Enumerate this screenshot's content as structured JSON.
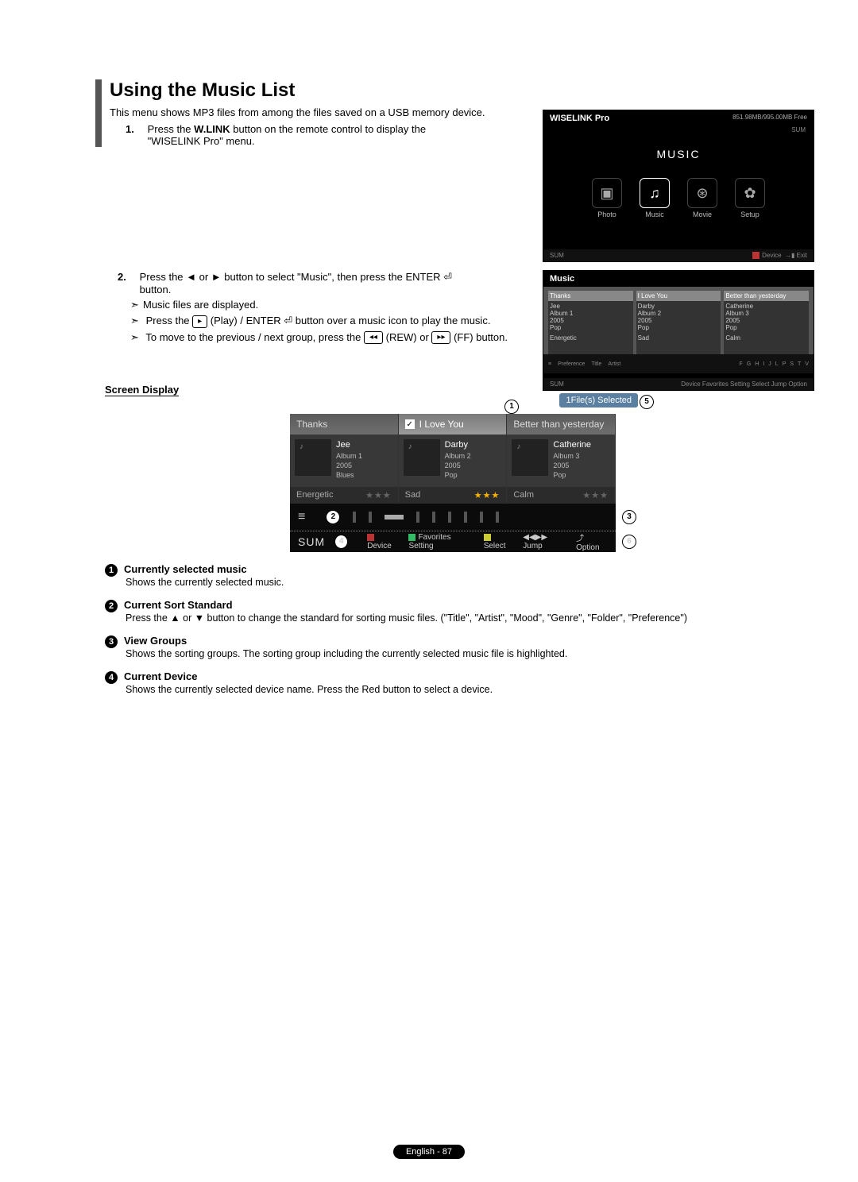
{
  "title": "Using the Music List",
  "intro": "This menu shows MP3 files from among the files saved on a USB memory device.",
  "steps": {
    "s1_pre": "Press the ",
    "s1_bold": "W.LINK",
    "s1_post": " button on the remote control to display the \"WISELINK Pro\" menu.",
    "s2_main": "Press the ◄ or ► button to select \"Music\", then press the ENTER ⏎ button.",
    "s2_a": "Music files are displayed.",
    "s2_b_pre": "Press the ",
    "s2_b_mid": " (Play) / ENTER ⏎ button over a music icon to play the music.",
    "s2_c_pre": "To move to the previous / next group, press the ",
    "s2_c_mid": " (REW) or ",
    "s2_c_end": " (FF) button."
  },
  "ss1": {
    "header": "WISELINK Pro",
    "storage": "851.98MB/995.00MB Free",
    "sub": "SUM",
    "main": "MUSIC",
    "icons": [
      "Photo",
      "Music",
      "Movie",
      "Setup"
    ],
    "foot_l": "SUM",
    "foot_r1": "Device",
    "foot_r2": "Exit"
  },
  "ss2": {
    "header": "Music",
    "tiles": [
      {
        "h": "Thanks",
        "n": "Jee",
        "a": "Album 1",
        "y": "2005",
        "g": "Pop",
        "m": "Energetic"
      },
      {
        "h": "I Love You",
        "n": "Darby",
        "a": "Album 2",
        "y": "2005",
        "g": "Pop",
        "m": "Sad"
      },
      {
        "h": "Better than yesterday",
        "n": "Catherine",
        "a": "Album 3",
        "y": "2005",
        "g": "Pop",
        "m": "Calm"
      }
    ],
    "sort_labels": [
      "Preference",
      "Title",
      "Artist"
    ],
    "letters": [
      "F",
      "G",
      "H",
      "I",
      "J",
      "L",
      "P",
      "S",
      "T",
      "V"
    ],
    "foot_l": "SUM",
    "foot_r": "Device    Favorites Setting    Select    Jump    Option"
  },
  "screen_display_label": "Screen Display",
  "selected_badge": "1File(s) Selected",
  "big": {
    "cards": [
      {
        "hdr": "Thanks",
        "name": "Jee",
        "album": "Album 1",
        "year": "2005",
        "genre": "Blues",
        "mood": "Energetic"
      },
      {
        "hdr": "I Love You",
        "name": "Darby",
        "album": "Album 2",
        "year": "2005",
        "genre": "Pop",
        "mood": "Sad"
      },
      {
        "hdr": "Better than yesterday",
        "name": "Catherine",
        "album": "Album 3",
        "year": "2005",
        "genre": "Pop",
        "mood": "Calm"
      }
    ],
    "foot": {
      "sum": "SUM",
      "device": "Device",
      "fav": "Favorites Setting",
      "select": "Select",
      "jump": "Jump",
      "option": "Option"
    }
  },
  "legend": {
    "i1h": "Currently selected music",
    "i1b": "Shows the currently selected music.",
    "i2h": "Current Sort Standard",
    "i2b": "Press the ▲ or ▼ button to change the standard for sorting music files. (\"Title\", \"Artist\", \"Mood\", \"Genre\", \"Folder\", \"Preference\")",
    "i3h": "View Groups",
    "i3b": "Shows the sorting groups. The sorting group including the currently selected music file is highlighted.",
    "i4h": "Current Device",
    "i4b": "Shows the currently selected device name. Press the Red button to select a device."
  },
  "page_foot": "English - 87",
  "callouts": {
    "c1": "1",
    "c2": "2",
    "c3": "3",
    "c4": "4",
    "c5": "5",
    "c6": "6"
  }
}
